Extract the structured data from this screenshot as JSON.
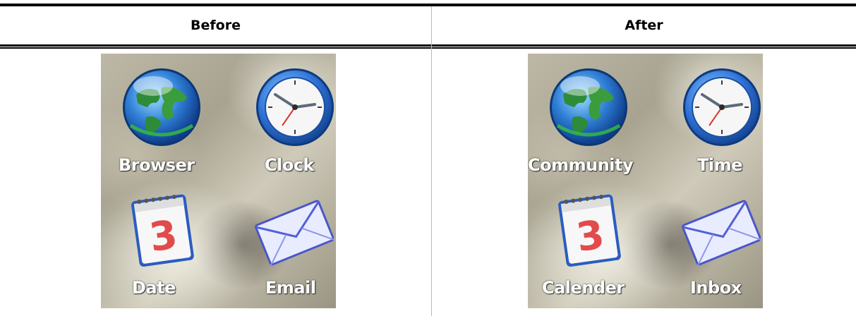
{
  "table": {
    "headers": [
      "Before",
      "After"
    ]
  },
  "before": {
    "apps": [
      {
        "label": "Browser",
        "icon": "globe-icon"
      },
      {
        "label": "Clock",
        "icon": "clock-icon"
      },
      {
        "label": "Date",
        "icon": "calendar-icon"
      },
      {
        "label": "Email",
        "icon": "envelope-icon"
      }
    ]
  },
  "after": {
    "apps": [
      {
        "label": "Community",
        "icon": "globe-icon"
      },
      {
        "label": "Time",
        "icon": "clock-icon"
      },
      {
        "label": "Calender",
        "icon": "calendar-icon"
      },
      {
        "label": "Inbox",
        "icon": "envelope-icon"
      }
    ]
  },
  "calendar_day": "3",
  "colors": {
    "rule": "#000000",
    "divider": "#b8b8b8",
    "label_text": "#ffffff"
  }
}
